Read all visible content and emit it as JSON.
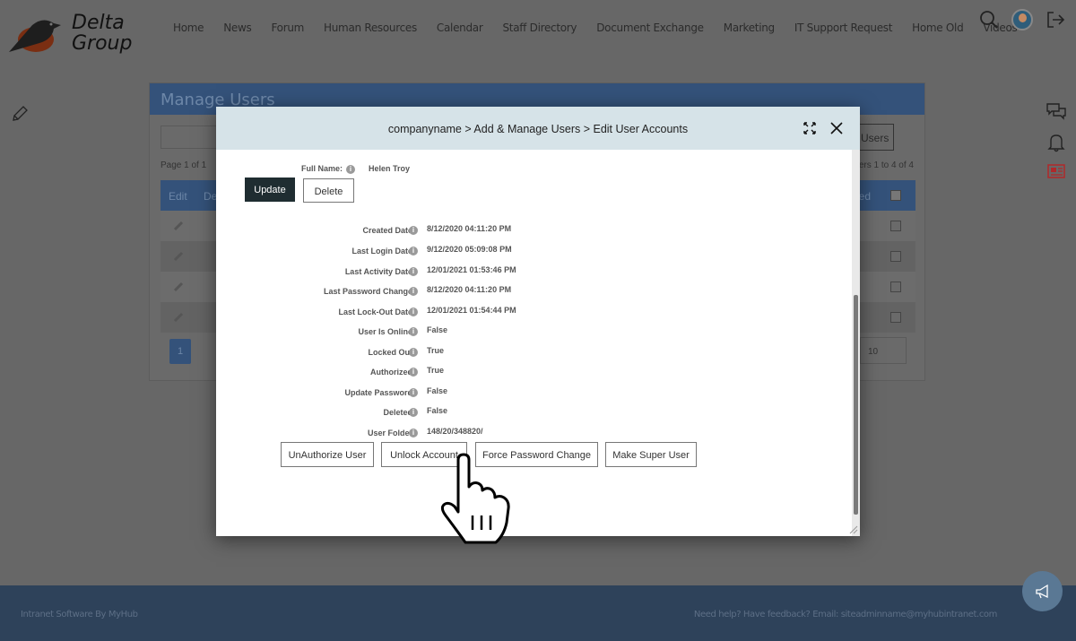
{
  "brand": {
    "name_line1": "Delta",
    "name_line2": "Group"
  },
  "nav": [
    "Home",
    "News",
    "Forum",
    "Human Resources",
    "Calendar",
    "Staff Directory",
    "Document Exchange",
    "Marketing",
    "IT Support Request",
    "Home Old",
    "Videos"
  ],
  "background_panel": {
    "title": "Manage Users",
    "users_button": "Users",
    "page_info": "Page 1 of 1",
    "range_info": "ers 1 to 4 of 4",
    "columns": [
      "Edit",
      "De",
      "led"
    ],
    "page_number": "1",
    "page_size": "10"
  },
  "modal": {
    "title": "companyname > Add & Manage Users > Edit User Accounts",
    "full_name_label": "Full Name:",
    "full_name": "Helen Troy",
    "update": "Update",
    "delete": "Delete",
    "fields": [
      {
        "label": "Created Date:",
        "value": "8/12/2020 04:11:20 PM"
      },
      {
        "label": "Last Login Date:",
        "value": "9/12/2020 05:09:08 PM"
      },
      {
        "label": "Last Activity Date:",
        "value": "12/01/2021 01:53:46 PM"
      },
      {
        "label": "Last Password Change:",
        "value": "8/12/2020 04:11:20 PM"
      },
      {
        "label": "Last Lock-Out Date:",
        "value": "12/01/2021 01:54:44 PM"
      },
      {
        "label": "User Is Online:",
        "value": "False"
      },
      {
        "label": "Locked Out:",
        "value": "True"
      },
      {
        "label": "Authorized:",
        "value": "True"
      },
      {
        "label": "Update Password:",
        "value": "False"
      },
      {
        "label": "Deleted:",
        "value": "False"
      },
      {
        "label": "User Folder:",
        "value": "148/20/348820/"
      }
    ],
    "actions": [
      "UnAuthorize User",
      "Unlock Account",
      "Force Password Change",
      "Make Super User"
    ]
  },
  "footer": {
    "left": "Intranet Software By MyHub",
    "right": "Need help? Have feedback? Email: siteadminname@myhubintranet.com"
  },
  "colors": {
    "overlay_bg": "#676767",
    "header_blue": "#34527a",
    "footer": "#2e425a",
    "modal_header": "#d6e3e8",
    "update_button": "#1f2d31",
    "news_icon": "#b0282a"
  }
}
